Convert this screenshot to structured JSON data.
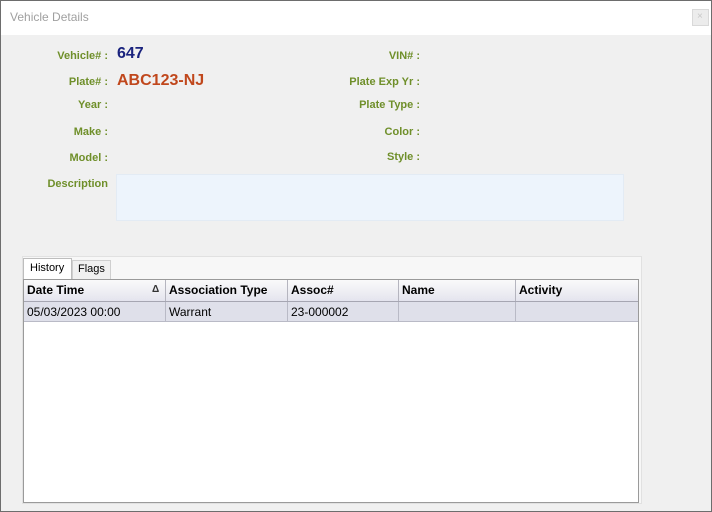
{
  "window": {
    "title": "Vehicle Details",
    "close_label": "×"
  },
  "fields": {
    "vehicle_label": "Vehicle# :",
    "vehicle_value": "647",
    "plate_label": "Plate# :",
    "plate_value": "ABC123-NJ",
    "year_label": "Year :",
    "make_label": "Make :",
    "model_label": "Model :",
    "description_label": "Description",
    "vin_label": "VIN# :",
    "plate_exp_label": "Plate Exp Yr :",
    "plate_type_label": "Plate Type :",
    "color_label": "Color :",
    "style_label": "Style :"
  },
  "tabs": [
    {
      "label": "History",
      "active": true
    },
    {
      "label": "Flags",
      "active": false
    }
  ],
  "grid": {
    "columns": [
      "Date Time",
      "Association Type",
      "Assoc#",
      "Name",
      "Activity"
    ],
    "sort_indicator": "Δ",
    "rows": [
      [
        "05/03/2023 00:00",
        "Warrant",
        "23-000002",
        "",
        ""
      ]
    ]
  }
}
